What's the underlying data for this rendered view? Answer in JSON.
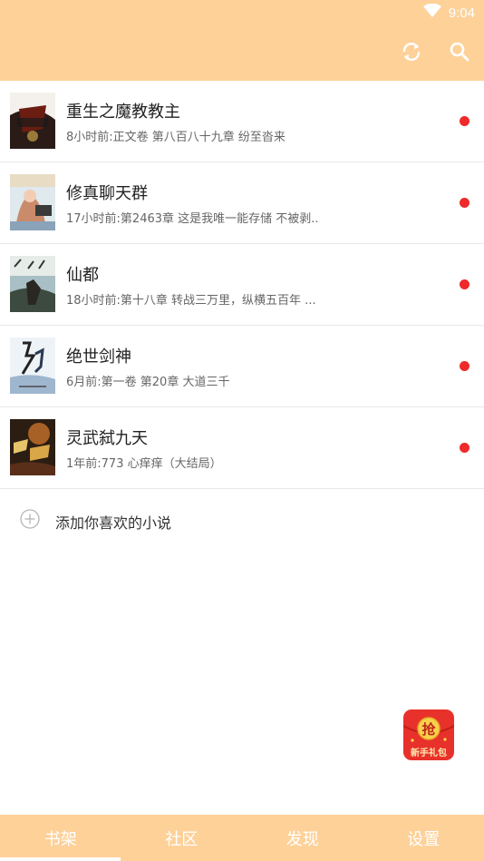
{
  "status_bar": {
    "time": "9:04",
    "icons": [
      "wifi-icon"
    ]
  },
  "toolbar": {
    "icons": [
      "refresh-icon",
      "search-icon"
    ]
  },
  "books": [
    {
      "title": "重生之魔教教主",
      "update": "8小时前:正文卷 第八百八十九章 纷至沓来"
    },
    {
      "title": "修真聊天群",
      "update": "17小时前:第2463章 这是我唯一能存储 不被剥..."
    },
    {
      "title": "仙都",
      "update": "18小时前:第十八章 转战三万里，纵横五百年 ..."
    },
    {
      "title": "绝世剑神",
      "update": "6月前:第一卷 第20章 大道三千"
    },
    {
      "title": "灵武弑九天",
      "update": "1年前:773 心痒痒（大结局）"
    }
  ],
  "add_novel": {
    "label": "添加你喜欢的小说"
  },
  "red_packet": {
    "top_char": "抢",
    "label": "新手礼包"
  },
  "bottom_nav": {
    "items": [
      {
        "label": "书架"
      },
      {
        "label": "社区"
      },
      {
        "label": "发现"
      },
      {
        "label": "设置"
      }
    ],
    "active_index": 0
  },
  "colors": {
    "accent": "#fed199",
    "unread_dot": "#ee2a2a",
    "red_packet": "#e8312a"
  }
}
